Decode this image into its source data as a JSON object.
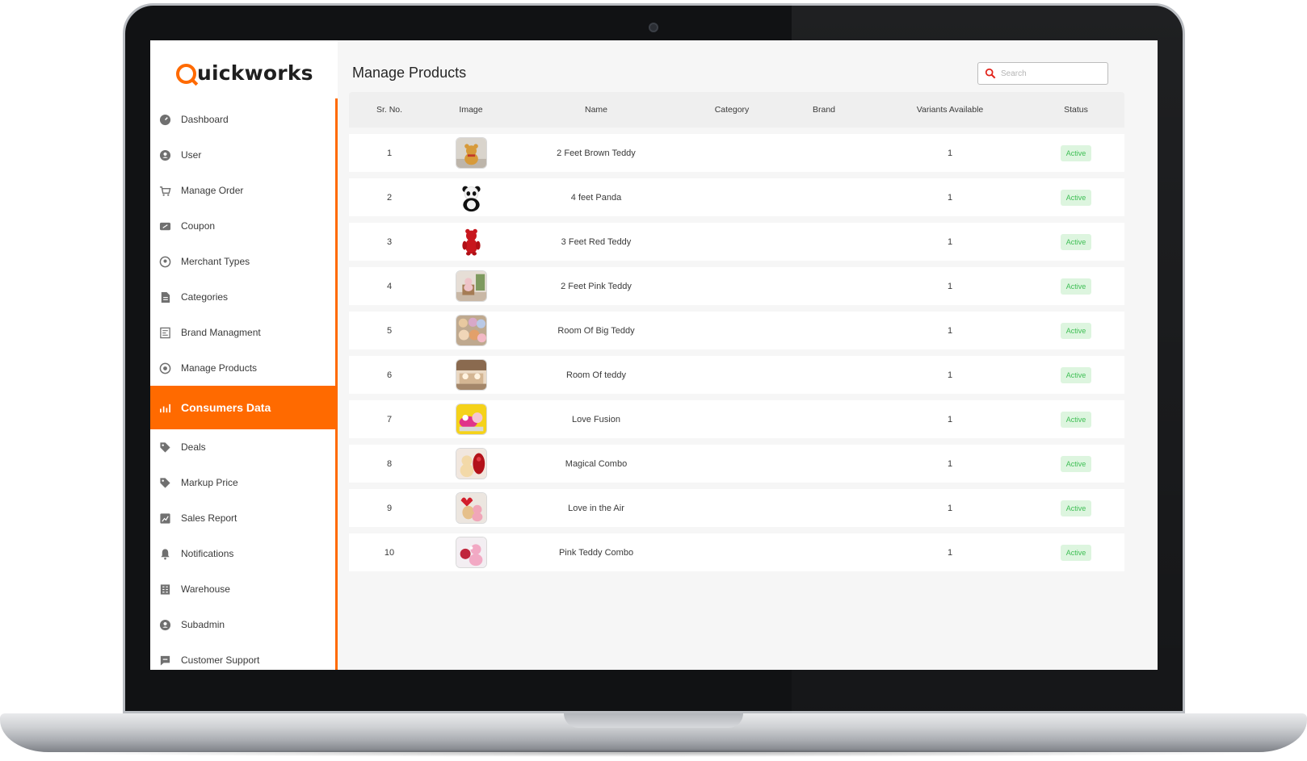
{
  "brand": {
    "logo_first": "Q",
    "logo_rest": "uickworks",
    "accent_color": "#ff6a00"
  },
  "sidebar": {
    "items": [
      {
        "label": "Dashboard",
        "icon": "dashboard-icon"
      },
      {
        "label": "User",
        "icon": "user-icon"
      },
      {
        "label": "Manage Order",
        "icon": "cart-icon"
      },
      {
        "label": "Coupon",
        "icon": "coupon-icon"
      },
      {
        "label": "Merchant Types",
        "icon": "merchant-icon"
      },
      {
        "label": "Categories",
        "icon": "categories-icon"
      },
      {
        "label": "Brand Managment",
        "icon": "brand-icon"
      },
      {
        "label": "Manage Products",
        "icon": "products-icon"
      },
      {
        "label": "Consumers Data",
        "icon": "chart-icon",
        "active": true
      },
      {
        "label": "Deals",
        "icon": "tag-icon"
      },
      {
        "label": "Markup Price",
        "icon": "price-tag-icon"
      },
      {
        "label": "Sales Report",
        "icon": "report-icon"
      },
      {
        "label": "Notifications",
        "icon": "bell-icon"
      },
      {
        "label": "Warehouse",
        "icon": "warehouse-icon"
      },
      {
        "label": "Subadmin",
        "icon": "subadmin-icon"
      },
      {
        "label": "Customer Support",
        "icon": "support-icon"
      }
    ]
  },
  "page": {
    "title": "Manage Products"
  },
  "search": {
    "placeholder": "Search",
    "icon": "search-icon"
  },
  "table": {
    "columns": [
      "Sr. No.",
      "Image",
      "Name",
      "Category",
      "Brand",
      "Variants Available",
      "Status"
    ],
    "rows": [
      {
        "sr": "1",
        "name": "2 Feet Brown Teddy",
        "category": "",
        "brand": "",
        "variants": "1",
        "status": "Active"
      },
      {
        "sr": "2",
        "name": "4 feet Panda",
        "category": "",
        "brand": "",
        "variants": "1",
        "status": "Active"
      },
      {
        "sr": "3",
        "name": "3 Feet Red Teddy",
        "category": "",
        "brand": "",
        "variants": "1",
        "status": "Active"
      },
      {
        "sr": "4",
        "name": "2 Feet Pink Teddy",
        "category": "",
        "brand": "",
        "variants": "1",
        "status": "Active"
      },
      {
        "sr": "5",
        "name": "Room Of Big Teddy",
        "category": "",
        "brand": "",
        "variants": "1",
        "status": "Active"
      },
      {
        "sr": "6",
        "name": "Room Of teddy",
        "category": "",
        "brand": "",
        "variants": "1",
        "status": "Active"
      },
      {
        "sr": "7",
        "name": "Love Fusion",
        "category": "",
        "brand": "",
        "variants": "1",
        "status": "Active"
      },
      {
        "sr": "8",
        "name": "Magical Combo",
        "category": "",
        "brand": "",
        "variants": "1",
        "status": "Active"
      },
      {
        "sr": "9",
        "name": "Love in the Air",
        "category": "",
        "brand": "",
        "variants": "1",
        "status": "Active"
      },
      {
        "sr": "10",
        "name": "Pink Teddy Combo",
        "category": "",
        "brand": "",
        "variants": "1",
        "status": "Active"
      }
    ]
  },
  "colors": {
    "active_bg": "#ddf5df",
    "active_text": "#3fbf55",
    "search_icon": "#e2231a"
  }
}
